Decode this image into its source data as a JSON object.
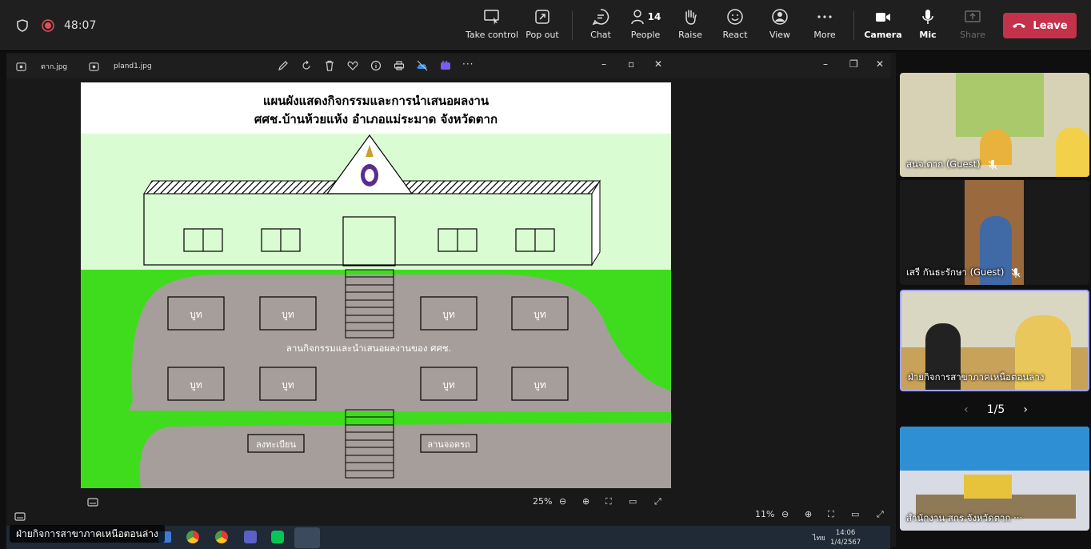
{
  "call": {
    "timer": "48:07"
  },
  "toolbar": {
    "take_control": "Take control",
    "pop_out": "Pop out",
    "chat": "Chat",
    "people": "People",
    "people_count": "14",
    "raise": "Raise",
    "react": "React",
    "view": "View",
    "more": "More",
    "camera": "Camera",
    "mic": "Mic",
    "share": "Share",
    "leave": "Leave"
  },
  "viewer": {
    "tabs": [
      {
        "label": "ตาก.jpg"
      },
      {
        "label": "pland1.jpg"
      }
    ],
    "inner_zoom": "25%",
    "outer_zoom": "11%"
  },
  "plan": {
    "title_line1": "แผนผังแสดงกิจกรรมและการนำเสนอผลงาน",
    "title_line2": "ศศช.บ้านห้วยแห้ง อำเภอแม่ระมาด จังหวัดตาก",
    "booth": "บูท",
    "plaza": "ลานกิจกรรมและนำเสนอผลงานของ ศศช.",
    "register": "ลงทะเบียน",
    "parking": "ลานจอดรถ"
  },
  "colors": {
    "grass": "#3fdc1e",
    "paved": "#a59e9b",
    "sky": "#dafcd2",
    "leave": "#c4314b"
  },
  "presenter": "ฝ่ายกิจการสาขาภาคเหนือตอนล่าง",
  "gallery": {
    "tiles": [
      {
        "name": "สนจ.ตาก (Guest)"
      },
      {
        "name": "เสรี กันธะรักษา (Guest)"
      },
      {
        "name": "ฝ่ายกิจการสาขาภาคเหนือตอนล่าง"
      },
      {
        "name": "สำนักงาน สกร.จังหวัดตาก ···"
      }
    ],
    "page": "1/5"
  },
  "taskbar": {
    "time": "14:06",
    "date": "1/4/2567",
    "lang": "ไทย"
  }
}
